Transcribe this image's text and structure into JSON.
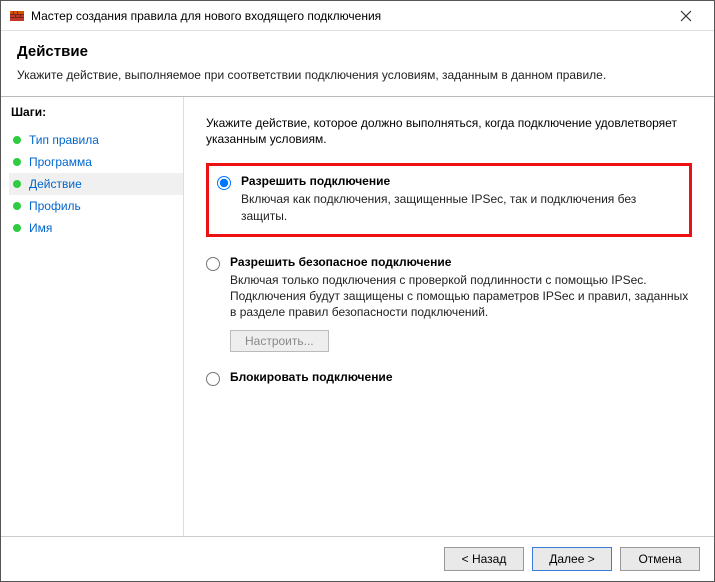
{
  "window": {
    "title": "Мастер создания правила для нового входящего подключения"
  },
  "header": {
    "heading": "Действие",
    "subtitle": "Укажите действие, выполняемое при соответствии подключения условиям, заданным в данном правиле."
  },
  "sidebar": {
    "title": "Шаги:",
    "steps": [
      {
        "label": "Тип правила"
      },
      {
        "label": "Программа"
      },
      {
        "label": "Действие"
      },
      {
        "label": "Профиль"
      },
      {
        "label": "Имя"
      }
    ],
    "active_index": 2
  },
  "content": {
    "intro": "Укажите действие, которое должно выполняться, когда подключение удовлетворяет указанным условиям.",
    "options": [
      {
        "label": "Разрешить подключение",
        "desc": "Включая как подключения, защищенные IPSec, так и подключения без защиты."
      },
      {
        "label": "Разрешить безопасное подключение",
        "desc": "Включая только подключения с проверкой подлинности с помощью IPSec. Подключения будут защищены с помощью параметров IPSec и правил, заданных в разделе правил безопасности подключений."
      },
      {
        "label": "Блокировать подключение",
        "desc": ""
      }
    ],
    "configure_btn": "Настроить...",
    "selected_option": 0
  },
  "footer": {
    "back": "< Назад",
    "next": "Далее >",
    "cancel": "Отмена"
  }
}
